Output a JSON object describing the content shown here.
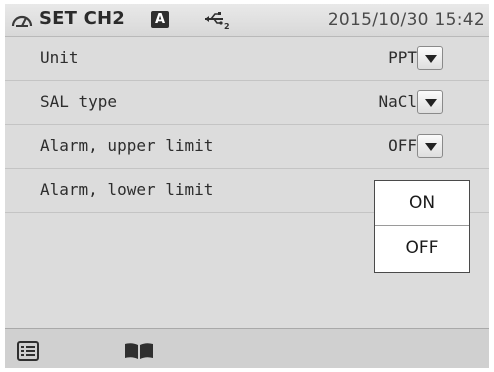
{
  "header": {
    "gauge_icon": "gauge-icon",
    "title": "SET CH2",
    "mode_badge": "A",
    "usb_icon": "usb-icon",
    "usb_badge": "2",
    "datetime": "2015/10/30 15:42"
  },
  "settings": [
    {
      "label": "Unit",
      "value": "PPT",
      "has_dropdown": true
    },
    {
      "label": "SAL type",
      "value": "NaCl",
      "has_dropdown": true
    },
    {
      "label": "Alarm, upper limit",
      "value": "OFF",
      "has_dropdown": true
    },
    {
      "label": "Alarm, lower limit",
      "value": "",
      "has_dropdown": false
    }
  ],
  "popup": {
    "options": [
      "ON",
      "OFF"
    ]
  },
  "footer": {
    "list_icon": "list-icon",
    "manual_icon": "book-icon"
  },
  "colors": {
    "background": "#dcdcdc",
    "popup_bg": "#ffffff",
    "text": "#2d2d2d"
  }
}
